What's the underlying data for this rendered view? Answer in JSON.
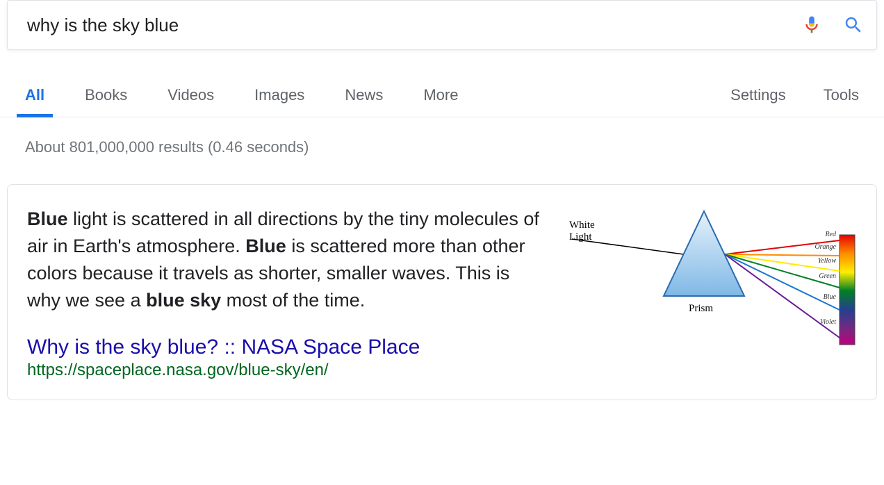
{
  "search": {
    "query": "why is the sky blue"
  },
  "tabs": {
    "items": [
      "All",
      "Books",
      "Videos",
      "Images",
      "News",
      "More"
    ],
    "activeIndex": 0,
    "right": [
      "Settings",
      "Tools"
    ]
  },
  "stats": "About 801,000,000 results (0.46 seconds)",
  "answer": {
    "snippet_parts": {
      "b1": "Blue",
      "t1": " light is scattered in all directions by the tiny molecules of air in Earth's atmosphere. ",
      "b2": "Blue",
      "t2": " is scattered more than other colors because it travels as shorter, smaller waves. This is why we see a ",
      "b3": "blue sky",
      "t3": " most of the time."
    },
    "title": "Why is the sky blue? :: NASA Space Place",
    "url": "https://spaceplace.nasa.gov/blue-sky/en/"
  },
  "diagram": {
    "white_light": "White\nLight",
    "prism": "Prism",
    "colors": [
      "Red",
      "Orange",
      "Yellow",
      "Green",
      "Blue",
      "Violet"
    ]
  }
}
